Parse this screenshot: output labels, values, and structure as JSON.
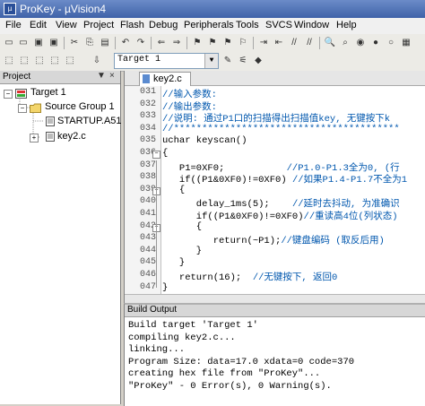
{
  "window": {
    "title": "ProKey  - µVision4"
  },
  "menu": [
    "File",
    "Edit",
    "View",
    "Project",
    "Flash",
    "Debug",
    "Peripherals",
    "Tools",
    "SVCS",
    "Window",
    "Help"
  ],
  "toolbar": {
    "target": "Target 1"
  },
  "project_panel": {
    "header": "Project",
    "header_controls": [
      "▼",
      "×"
    ],
    "tree": {
      "root": "Target 1",
      "group": "Source Group 1",
      "files": [
        "STARTUP.A51",
        "key2.c"
      ]
    }
  },
  "editor": {
    "tab": "key2.c",
    "lines": [
      {
        "n": "031",
        "text": "//输入参数:"
      },
      {
        "n": "032",
        "text": "//输出参数:"
      },
      {
        "n": "033",
        "text": "//说明: 通过P1口的扫描得出扫描值key, 无键按下k"
      },
      {
        "n": "034",
        "text": "//****************************************"
      },
      {
        "n": "035",
        "text": "uchar keyscan()"
      },
      {
        "n": "036",
        "text": "{"
      },
      {
        "n": "037",
        "text": "   P1=0XF0;           //P1.0-P1.3全为0, (行"
      },
      {
        "n": "038",
        "text": "   if((P1&0XF0)!=0XF0) //如果P1.4-P1.7不全为1"
      },
      {
        "n": "039",
        "text": "   {"
      },
      {
        "n": "040",
        "text": "      delay_1ms(5);    //延时去抖动, 为准确识"
      },
      {
        "n": "041",
        "text": "      if((P1&0XF0)!=0XF0)//重读高4位(列状态)"
      },
      {
        "n": "042",
        "text": "      {"
      },
      {
        "n": "043",
        "text": "         return(~P1);//键盘编码 (取反后用)"
      },
      {
        "n": "044",
        "text": "      }"
      },
      {
        "n": "045",
        "text": "   }"
      },
      {
        "n": "046",
        "text": "   return(16);  //无键按下, 返回0"
      },
      {
        "n": "047",
        "text": "}"
      }
    ]
  },
  "build_output": {
    "header": "Build Output",
    "lines": [
      "Build target 'Target 1'",
      "compiling key2.c...",
      "linking...",
      "Program Size: data=17.0 xdata=0 code=370",
      "creating hex file from \"ProKey\"...",
      "\"ProKey\" - 0 Error(s), 0 Warning(s)."
    ]
  },
  "colors": {
    "comment": "#0057ae",
    "titlebar": "#3f62a8"
  }
}
